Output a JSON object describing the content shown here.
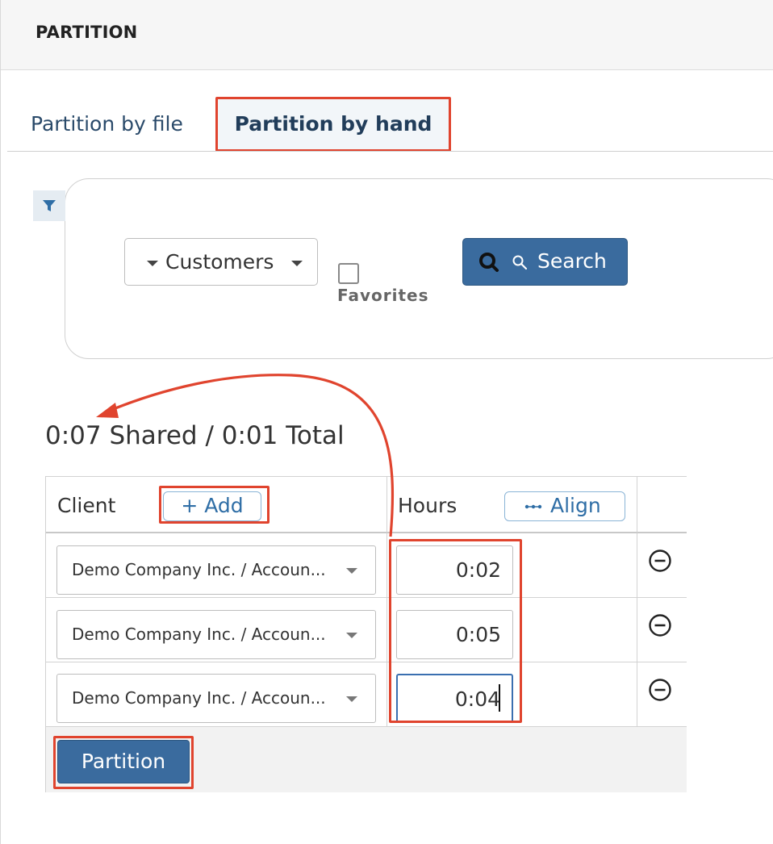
{
  "header": {
    "title": "PARTITION"
  },
  "tabs": [
    {
      "label": "Partition by file",
      "active": false
    },
    {
      "label": "Partition by hand",
      "active": true
    }
  ],
  "filter": {
    "entity_select": "Customers",
    "favorites_label": "Favorites",
    "favorites_checked": false,
    "search_label": "Search"
  },
  "summary": {
    "text": "0:07 Shared / 0:01 Total"
  },
  "table": {
    "client_header": "Client",
    "add_label": "+ Add",
    "hours_header": "Hours",
    "align_label": "Align",
    "rows": [
      {
        "client": "Demo Company Inc. / Accoun...",
        "hours": "0:02"
      },
      {
        "client": "Demo Company Inc. / Accoun...",
        "hours": "0:05"
      },
      {
        "client": "Demo Company Inc. / Accoun...",
        "hours": "0:04"
      }
    ]
  },
  "actions": {
    "partition_label": "Partition"
  },
  "icons": {
    "filter": "filter-icon",
    "search": "search-icon",
    "remove": "minus-circle-icon",
    "align": "ellipsis-icon"
  },
  "colors": {
    "primary": "#3a6b9e",
    "annotation": "#e0442e",
    "tab_text": "#2a4a6a",
    "link": "#2f6ea6"
  }
}
